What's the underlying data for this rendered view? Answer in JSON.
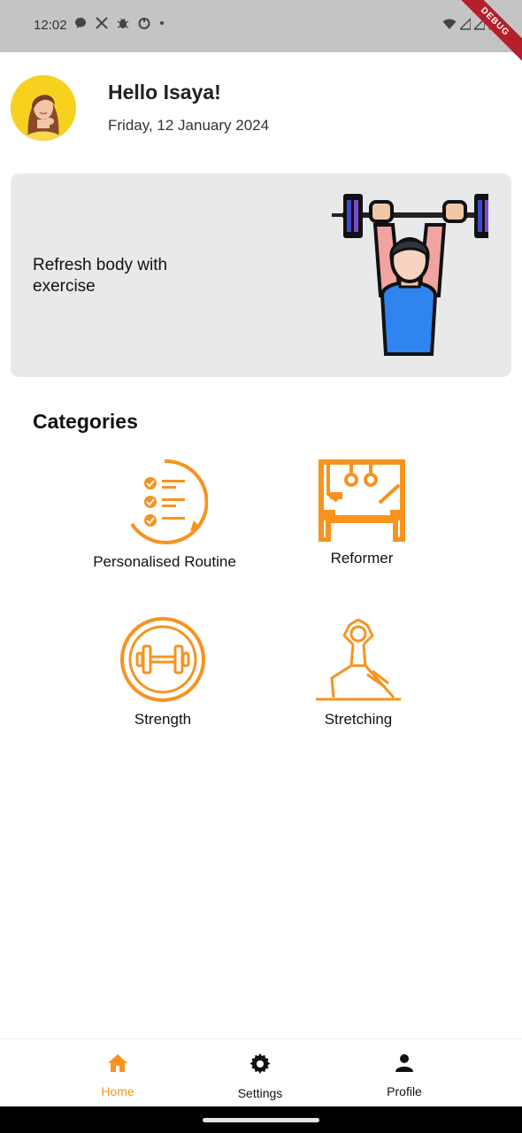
{
  "status_bar": {
    "time": "12:02",
    "debug_label": "DEBUG",
    "left_icons": [
      "messages-icon",
      "x-icon",
      "bug-icon",
      "shield-icon",
      "dot-icon"
    ],
    "right_icons": [
      "wifi-icon",
      "signal-icon",
      "signal-icon",
      "battery-icon"
    ]
  },
  "header": {
    "greeting": "Hello Isaya!",
    "date": "Friday, 12 January 2024"
  },
  "banner": {
    "text": "Refresh body with exercise"
  },
  "categories": {
    "title": "Categories",
    "items": [
      {
        "label": "Personalised Routine",
        "icon": "checklist-icon"
      },
      {
        "label": "Reformer",
        "icon": "reformer-icon"
      },
      {
        "label": "Strength",
        "icon": "dumbbell-icon"
      },
      {
        "label": "Stretching",
        "icon": "yoga-icon"
      }
    ]
  },
  "bottom_nav": {
    "items": [
      {
        "label": "Home",
        "icon": "home-icon",
        "active": true
      },
      {
        "label": "Settings",
        "icon": "gear-icon",
        "active": false
      },
      {
        "label": "Profile",
        "icon": "person-icon",
        "active": false
      }
    ]
  },
  "colors": {
    "accent": "#f7931e",
    "status_bar": "#c4c4c4",
    "banner_bg": "#e8e9ea",
    "nav_inactive": "#111111",
    "debug_ribbon": "#b3202a"
  }
}
